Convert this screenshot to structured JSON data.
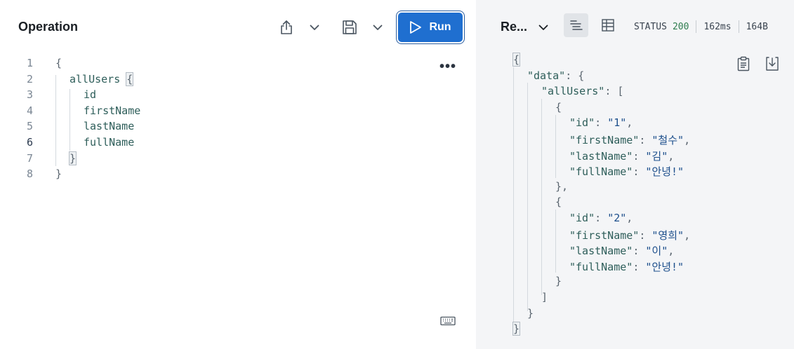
{
  "operation": {
    "title": "Operation",
    "run_label": "Run",
    "lines": [
      {
        "num": "1",
        "text": "{"
      },
      {
        "num": "2",
        "text": "allUsers {"
      },
      {
        "num": "3",
        "text": "id"
      },
      {
        "num": "4",
        "text": "firstName"
      },
      {
        "num": "5",
        "text": "lastName"
      },
      {
        "num": "6",
        "text": "fullName"
      },
      {
        "num": "7",
        "text": "}"
      },
      {
        "num": "8",
        "text": "}"
      }
    ]
  },
  "response": {
    "title": "Re...",
    "status_label": "STATUS",
    "status_code": "200",
    "time": "162ms",
    "size": "164B"
  },
  "icons": {
    "share": "share-icon",
    "save": "save-icon",
    "run": "play-icon",
    "more": "more-icon",
    "keyboard": "keyboard-icon",
    "text_view": "text-view-icon",
    "table_view": "table-view-icon",
    "copy": "clipboard-icon",
    "download": "download-icon"
  },
  "colors": {
    "run_button": "#1f6fd0",
    "response_bg": "#f4f5f7",
    "status_ok": "#2e7d4f"
  }
}
